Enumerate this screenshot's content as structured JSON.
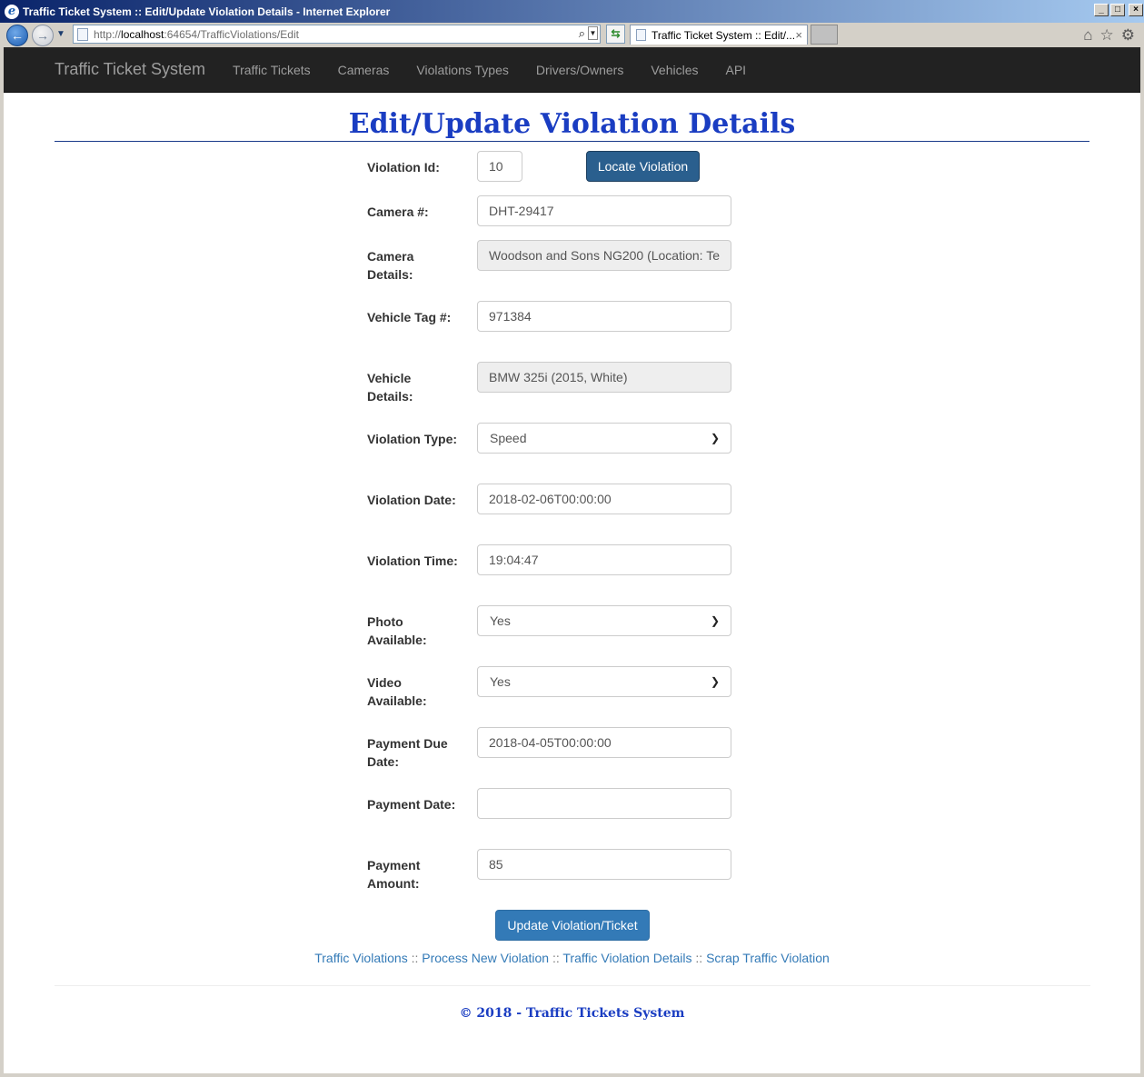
{
  "window": {
    "title": "Traffic Ticket System :: Edit/Update Violation Details - Internet Explorer",
    "controls": [
      "_",
      "□",
      "×"
    ]
  },
  "browser": {
    "address_prefix": "http://",
    "address_host": "localhost",
    "address_rest": ":64654/TrafficViolations/Edit",
    "tab_title": "Traffic Ticket System :: Edit/...",
    "tab_close": "×"
  },
  "nav": {
    "brand": "Traffic Ticket System",
    "links": [
      "Traffic Tickets",
      "Cameras",
      "Violations Types",
      "Drivers/Owners",
      "Vehicles",
      "API"
    ]
  },
  "page": {
    "title": "Edit/Update Violation Details"
  },
  "form": {
    "violation_id": {
      "label": "Violation Id:",
      "value": "10"
    },
    "locate_button": "Locate Violation",
    "camera_number": {
      "label": "Camera #:",
      "value": "DHT-29417"
    },
    "camera_details": {
      "label": "Camera Details:",
      "value": "Woodson and Sons NG200 (Location: Te"
    },
    "vehicle_tag": {
      "label": "Vehicle Tag #:",
      "value": "971384"
    },
    "vehicle_details": {
      "label": "Vehicle Details:",
      "value": "BMW 325i (2015, White)"
    },
    "violation_type": {
      "label": "Violation Type:",
      "value": "Speed"
    },
    "violation_date": {
      "label": "Violation Date:",
      "value": "2018-02-06T00:00:00"
    },
    "violation_time": {
      "label": "Violation Time:",
      "value": "19:04:47"
    },
    "photo_available": {
      "label": "Photo Available:",
      "value": "Yes"
    },
    "video_available": {
      "label": "Video Available:",
      "value": "Yes"
    },
    "payment_due_date": {
      "label": "Payment Due Date:",
      "value": "2018-04-05T00:00:00"
    },
    "payment_date": {
      "label": "Payment Date:",
      "value": ""
    },
    "payment_amount": {
      "label": "Payment Amount:",
      "value": "85"
    },
    "update_button": "Update Violation/Ticket"
  },
  "footer_links": {
    "items": [
      "Traffic Violations",
      "Process New Violation",
      "Traffic Violation Details",
      "Scrap Traffic Violation"
    ],
    "separator": " :: "
  },
  "footer": {
    "copyright": "© 2018 - Traffic Tickets System"
  },
  "colors": {
    "title_blue": "#1a3dc2",
    "navbar_bg": "#222222",
    "link_blue": "#337ab7",
    "button_primary": "#337ab7"
  }
}
